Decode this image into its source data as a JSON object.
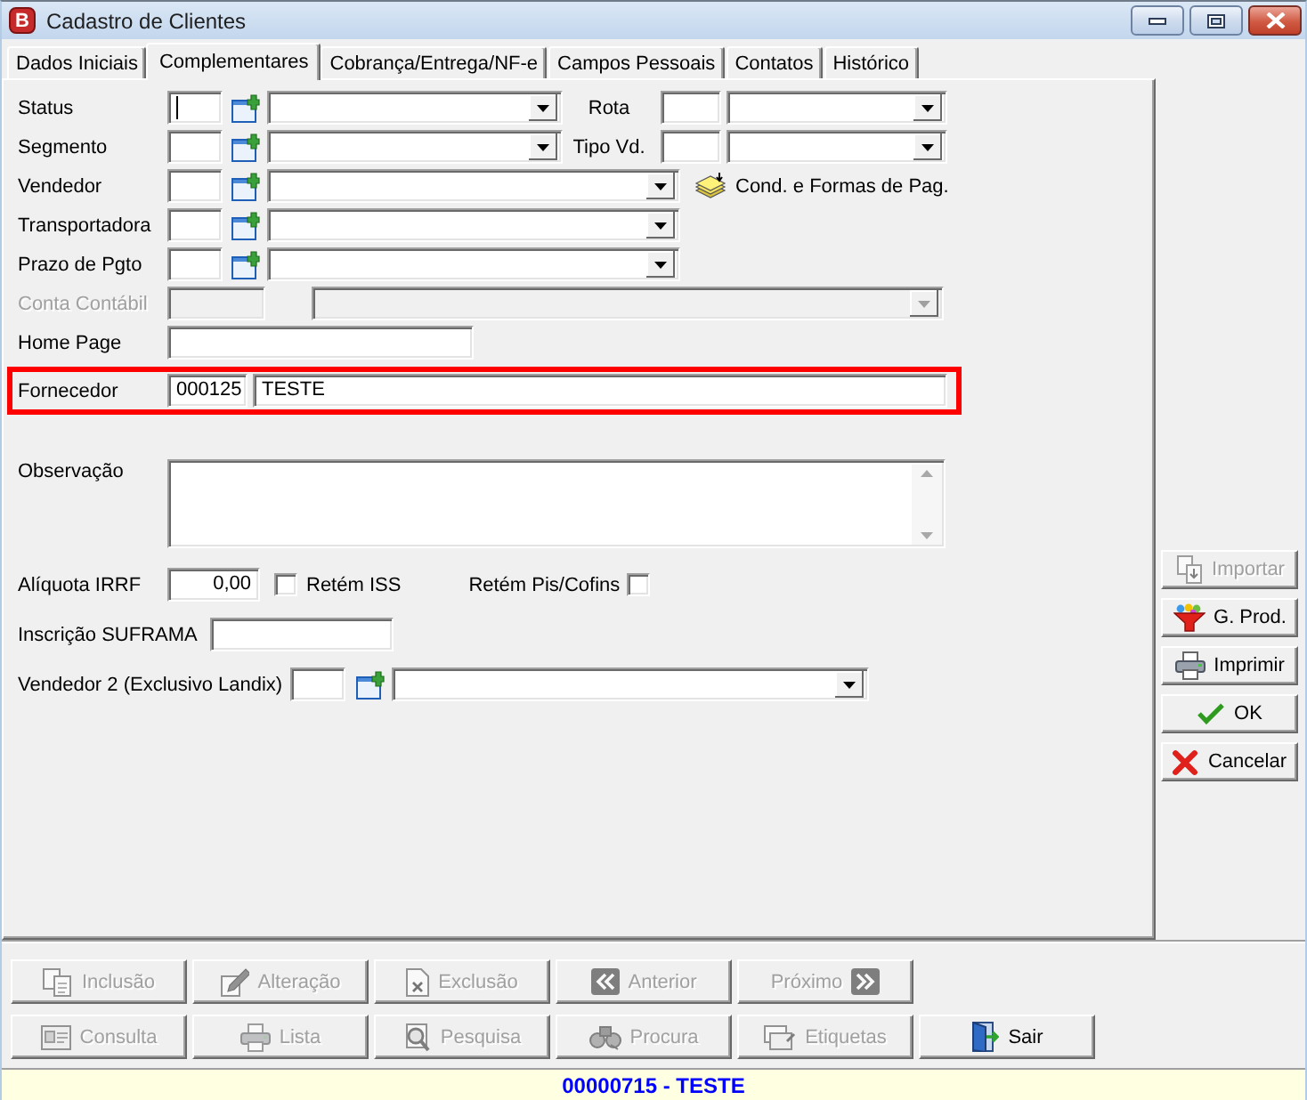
{
  "window": {
    "logo_letter": "B",
    "title": "Cadastro de Clientes"
  },
  "tabs": [
    {
      "label": "Dados Iniciais",
      "selected": false
    },
    {
      "label": "Complementares",
      "selected": true
    },
    {
      "label": "Cobrança/Entrega/NF-e",
      "selected": false
    },
    {
      "label": "Campos Pessoais",
      "selected": false
    },
    {
      "label": "Contatos",
      "selected": false
    },
    {
      "label": "Histórico",
      "selected": false
    }
  ],
  "form": {
    "status_row": {
      "label": "Status",
      "code_focused": true,
      "side_lookup": {
        "label": "Rota"
      }
    },
    "segment_row": {
      "label": "Segmento",
      "side_lookup": {
        "label": "Tipo Vd."
      }
    },
    "seller_row": {
      "label": "Vendedor",
      "side_link": "Cond. e Formas de Pag."
    },
    "carrier_row": {
      "label": "Transportadora"
    },
    "payment_term_row": {
      "label": "Prazo de Pgto"
    },
    "account_row": {
      "label": "Conta Contábil",
      "disabled": true
    },
    "home_page_row": {
      "label": "Home Page"
    },
    "supplier_row": {
      "label": "Fornecedor",
      "highlighted": true,
      "code": "000125",
      "name": "TESTE"
    },
    "notes_row": {
      "label": "Observação"
    },
    "tax_row": {
      "label": "Alíquota IRRF",
      "value": "0,00",
      "iss": {
        "label": "Retém ISS",
        "checked": false
      },
      "pis_cofins": {
        "label": "Retém Pis/Cofins",
        "checked": false
      }
    },
    "suframa_row": {
      "label": "Inscrição SUFRAMA"
    },
    "seller2_row": {
      "label": "Vendedor 2 (Exclusivo Landix)"
    }
  },
  "side_buttons": [
    {
      "label": "Importar",
      "disabled": true
    },
    {
      "label": "G. Prod.",
      "disabled": false
    },
    {
      "label": "Imprimir",
      "disabled": false
    },
    {
      "label": "OK",
      "disabled": false
    },
    {
      "label": "Cancelar",
      "disabled": false
    }
  ],
  "toolbar_rows": [
    [
      {
        "label": "Inclusão",
        "disabled": true
      },
      {
        "label": "Alteração",
        "disabled": true
      },
      {
        "label": "Exclusão",
        "disabled": true
      },
      {
        "label": "Anterior",
        "disabled": true
      },
      {
        "label": "Próximo",
        "disabled": true
      }
    ],
    [
      {
        "label": "Consulta",
        "disabled": true
      },
      {
        "label": "Lista",
        "disabled": true
      },
      {
        "label": "Pesquisa",
        "disabled": true
      },
      {
        "label": "Procura",
        "disabled": true
      },
      {
        "label": "Etiquetas",
        "disabled": true
      },
      {
        "label": "Sair",
        "disabled": false
      }
    ]
  ],
  "status_bar": {
    "text": "00000715 - TESTE"
  }
}
